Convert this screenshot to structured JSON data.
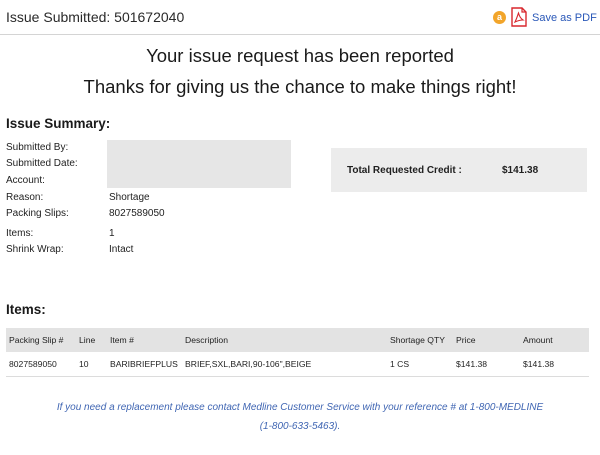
{
  "header": {
    "issue_title": "Issue Submitted: 501672040",
    "badge_text": "a",
    "save_pdf_label": "Save as PDF"
  },
  "headline": {
    "line1": "Your issue request has been reported",
    "line2": "Thanks for giving us the chance to make things right!"
  },
  "summary": {
    "title": "Issue Summary:",
    "labels": {
      "submitted_by": "Submitted By:",
      "submitted_date": "Submitted Date:",
      "account": "Account:",
      "reason": "Reason:",
      "packing_slips": "Packing Slips:",
      "items": "Items:",
      "shrink_wrap": "Shrink Wrap:"
    },
    "values": {
      "reason": "Shortage",
      "packing_slips": "8027589050",
      "items": "1",
      "shrink_wrap": "Intact"
    },
    "credit_label": "Total Requested Credit :",
    "credit_value": "$141.38"
  },
  "items_section": {
    "title": "Items:",
    "columns": [
      "Packing Slip #",
      "Line",
      "Item #",
      "Description",
      "Shortage QTY",
      "Price",
      "Amount"
    ],
    "rows": [
      [
        "8027589050",
        "10",
        "BARIBRIEFPLUS",
        "BRIEF,SXL,BARI,90-106\",BEIGE",
        "1 CS",
        "$141.38",
        "$141.38"
      ]
    ]
  },
  "footer": {
    "line1": "If you need a replacement please contact Medline Customer Service with your reference # at 1-800-MEDLINE",
    "line2": "(1-800-633-5463)."
  },
  "colors": {
    "link": "#2a58b8",
    "badge": "#f2a52a",
    "pdf_icon": "#d8272d",
    "footer_text": "#4066b3"
  },
  "icons": [
    "notification-badge-icon",
    "pdf-icon"
  ]
}
